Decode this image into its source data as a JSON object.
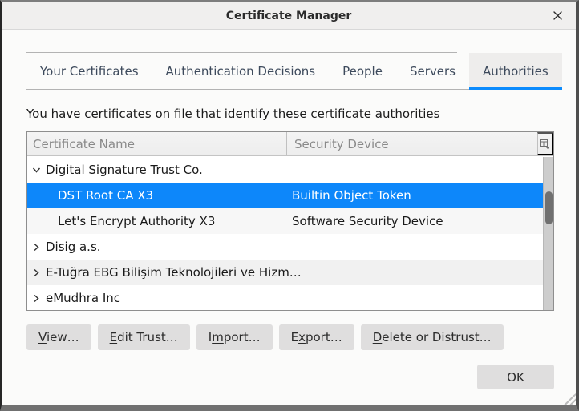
{
  "window": {
    "title": "Certificate Manager"
  },
  "tabs": [
    {
      "label": "Your Certificates",
      "active": false
    },
    {
      "label": "Authentication Decisions",
      "active": false
    },
    {
      "label": "People",
      "active": false
    },
    {
      "label": "Servers",
      "active": false
    },
    {
      "label": "Authorities",
      "active": true
    }
  ],
  "description": "You have certificates on file that identify these certificate authorities",
  "table": {
    "columns": [
      {
        "label": "Certificate Name"
      },
      {
        "label": "Security Device"
      }
    ],
    "column_picker_icon": "column-picker-icon",
    "rows": [
      {
        "kind": "group",
        "expanded": true,
        "selected": false,
        "name": "Digital Signature Trust Co.",
        "bg": "#ffffff"
      },
      {
        "kind": "leaf",
        "expanded": false,
        "selected": true,
        "name": "DST Root CA X3",
        "device": "Builtin Object Token"
      },
      {
        "kind": "leaf",
        "expanded": false,
        "selected": false,
        "name": "Let's Encrypt Authority X3",
        "device": "Software Security Device",
        "bg": "#f7f7f7"
      },
      {
        "kind": "group",
        "expanded": false,
        "selected": false,
        "name": "Disig a.s.",
        "bg": "#ffffff"
      },
      {
        "kind": "group",
        "expanded": false,
        "selected": false,
        "name": "E-Tuğra EBG Bilişim Teknolojileri ve Hizm…",
        "bg": "#f1f1f1"
      },
      {
        "kind": "group",
        "expanded": false,
        "selected": false,
        "name": "eMudhra Inc",
        "bg": "#ffffff"
      }
    ]
  },
  "buttons": [
    {
      "label": "View…",
      "accesskey_index": 0
    },
    {
      "label": "Edit Trust…",
      "accesskey_index": 0
    },
    {
      "label": "Import…",
      "accesskey_index": 1
    },
    {
      "label": "Export…",
      "accesskey_index": 1
    },
    {
      "label": "Delete or Distrust…",
      "accesskey_index": 0
    }
  ],
  "ok_button": {
    "label": "OK"
  },
  "colors": {
    "accent": "#0d87fa",
    "tab_underline": "#0b8bfd",
    "selection_text": "#ffffff",
    "titlebar_bg": "#f0efee",
    "active_tab_bg": "#eeedec"
  }
}
